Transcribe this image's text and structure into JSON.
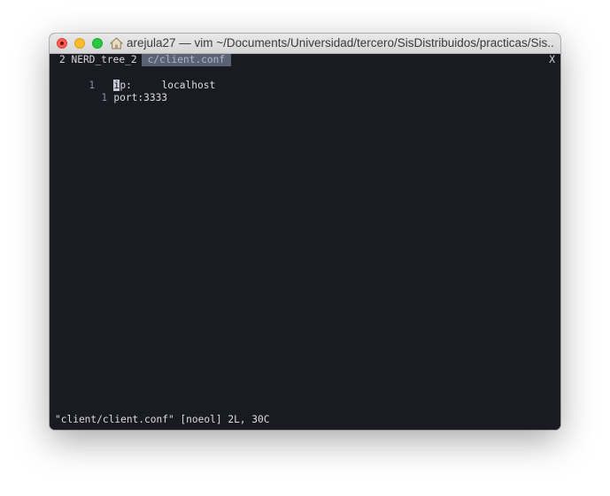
{
  "window": {
    "title": "arejula27 — vim ~/Documents/Universidad/tercero/SisDistribuidos/practicas/Sis...",
    "title_icon": "home-icon"
  },
  "tabline": {
    "tab1_label": "2 NERD_tree_2",
    "tab2_label": "c/client.conf",
    "close_label": "X"
  },
  "buffer": {
    "lines": [
      {
        "number": "1",
        "cursor_char": "i",
        "rest": "p:     localhost"
      },
      {
        "number": "1",
        "text": "port:3333"
      }
    ]
  },
  "status": {
    "message": "\"client/client.conf\" [noeol] 2L, 30C"
  },
  "colors": {
    "background": "#191a22",
    "active_tab": "#5a6274",
    "text": "#dcdcdc"
  }
}
